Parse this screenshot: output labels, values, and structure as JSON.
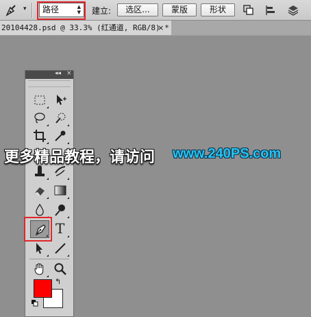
{
  "options_bar": {
    "tool_caret": "▾",
    "mode_select": {
      "value": "路径",
      "arrows": "▲▼"
    },
    "create_label": "建立:",
    "buttons": {
      "selection": "选区...",
      "mask": "蒙版",
      "shape": "形状"
    },
    "icons": [
      "path-operations-icon",
      "path-alignment-icon",
      "path-arrangement-icon"
    ]
  },
  "document": {
    "tab_title": "20104428.psd @ 33.3% (红通道, RGB/8) *",
    "close": "×"
  },
  "tools_panel": {
    "collapse": "◂◂",
    "close": "×",
    "type_tool_glyph": "T",
    "swap_glyph": "↰"
  },
  "colors": {
    "foreground": "#ff0000",
    "background": "#ffffff",
    "highlight": "#e0262b",
    "canvas": "#8f8f8f"
  },
  "watermark": {
    "text": "更多精品教程，请访问",
    "url": "www.240PS.com"
  }
}
